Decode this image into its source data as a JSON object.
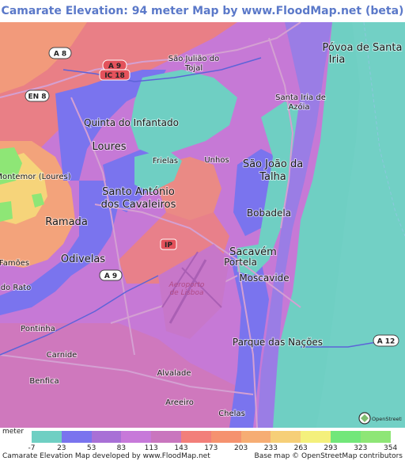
{
  "title": "Camarate Elevation: 94 meter Map by www.FloodMap.net (beta)",
  "places": {
    "povoa": [
      "Póvoa de Santa",
      "Iria"
    ],
    "sao_juliao": [
      "São Julião do",
      "Tojal"
    ],
    "santa_iria": [
      "Santa Iria de",
      "Azóia"
    ],
    "quinta": "Quinta do Infantado",
    "loures": "Loures",
    "frielas": "Frielas",
    "unhos": "Unhos",
    "sao_joao": [
      "São João da",
      "Talha"
    ],
    "montemor": "Montemor (Loures)",
    "santo_antonio": [
      "Santo António",
      "dos Cavaleiros"
    ],
    "ramada": "Ramada",
    "bobadela": "Bobadela",
    "famoes": "Famões",
    "odivelas": "Odivelas",
    "sacavem": "Sacavém",
    "do_rato": "do Rato",
    "portela": "Portela",
    "moscavide": "Moscavide",
    "airport": [
      "Aeroporto",
      "de Lisboa"
    ],
    "pontinha": "Pontinha",
    "parque": "Parque das Nações",
    "carnide": "Carnide",
    "benfica": "Benfica",
    "alvalade": "Alvalade",
    "areeiro": "Areeiro",
    "chelas": "Chelas"
  },
  "road_shields": {
    "a8": "A 8",
    "a9": "A 9",
    "ic18": "IC 18",
    "en8": "EN 8",
    "ip": "IP",
    "a12": "A 12",
    "a9b": "A 9"
  },
  "legend": {
    "unit": "meter",
    "ticks": [
      "-7",
      "23",
      "53",
      "83",
      "113",
      "143",
      "173",
      "203",
      "233",
      "263",
      "293",
      "323",
      "354"
    ],
    "colors": [
      "#6fcfc3",
      "#7a74ee",
      "#a870d6",
      "#c779d9",
      "#c976be",
      "#f27f7a",
      "#f5926f",
      "#f6ad74",
      "#f6cf78",
      "#f4f07c",
      "#72e77a",
      "#8ee676"
    ],
    "credit_left": "Camarate Elevation Map developed by www.FloodMap.net",
    "credit_right": "Base map © OpenStreetMap contributors",
    "osm_logo": "OpenStreetMap"
  }
}
